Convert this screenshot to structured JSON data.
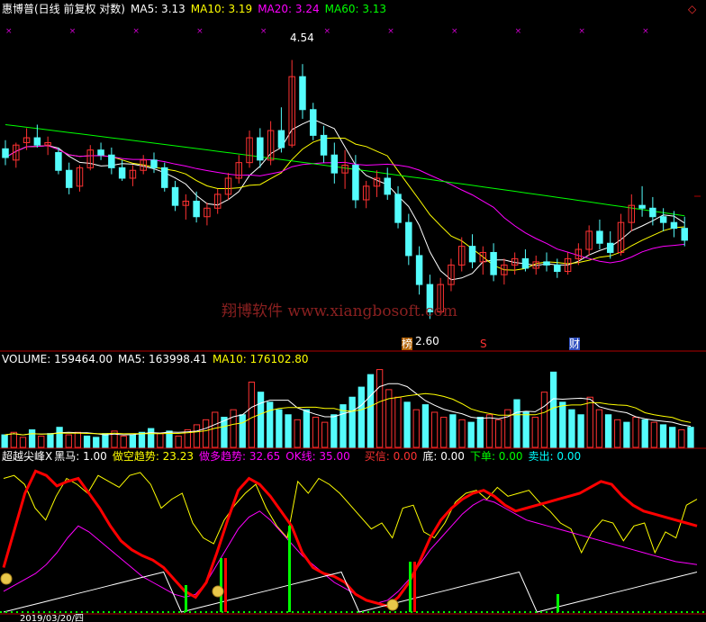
{
  "colors": {
    "bg": "#000000",
    "up": "#ff3232",
    "down": "#54fcfc",
    "ma5": "#ffffff",
    "ma10": "#ffff00",
    "ma20": "#ff00ff",
    "ma60": "#00ff00",
    "frame": "#b00000",
    "heima": "#ff0000",
    "kongtrend": "#ffff00",
    "duotrend": "#ff00ff",
    "ok": "#ffffff",
    "signal_green": "#00ff00",
    "watermark": "#7a1a1a"
  },
  "header": {
    "stock": "惠博普(日线 前复权 对数)",
    "ma5": "MA5: 3.13",
    "ma10": "MA10: 3.19",
    "ma20": "MA20: 3.24",
    "ma60": "MA60: 3.13"
  },
  "main_annotations": {
    "high_label": "4.54",
    "low_label": "2.60",
    "tag_bang": "榜",
    "tag_s": "S",
    "tag_cai": "财",
    "watermark": "翔博软件 www.xiangbosoft.com",
    "x_mark": "×",
    "diamond": "◇"
  },
  "volume_header": {
    "volume": "VOLUME: 159464.00",
    "ma5": "MA5: 163998.41",
    "ma10": "MA10: 176102.80"
  },
  "indicator_header": {
    "name": "超越尖峰X",
    "heima": "黑马: 1.00",
    "kong": "做空趋势: 23.23",
    "duo": "做多趋势: 32.65",
    "ok": "OK线: 35.00",
    "buy": "买信: 0.00",
    "bottom": "底: 0.00",
    "order": "下单: 0.00",
    "sell": "卖出: 0.00"
  },
  "date_label": "2019/03/20/四",
  "chart_data": [
    {
      "type": "candlestick",
      "title": "惠博普(日线 前复权 对数)",
      "series_names": [
        "MA5",
        "MA10",
        "MA20",
        "MA60"
      ],
      "y_range_estimate": [
        2.45,
        4.95
      ],
      "highest_labeled": 4.54,
      "lowest_labeled": 2.6,
      "ohlc": [
        [
          3.75,
          3.82,
          3.62,
          3.68
        ],
        [
          3.66,
          3.8,
          3.6,
          3.78
        ],
        [
          3.8,
          3.92,
          3.74,
          3.84
        ],
        [
          3.84,
          3.95,
          3.76,
          3.78
        ],
        [
          3.78,
          3.85,
          3.7,
          3.8
        ],
        [
          3.72,
          3.76,
          3.55,
          3.58
        ],
        [
          3.58,
          3.64,
          3.4,
          3.45
        ],
        [
          3.46,
          3.62,
          3.42,
          3.6
        ],
        [
          3.6,
          3.78,
          3.58,
          3.74
        ],
        [
          3.74,
          3.8,
          3.66,
          3.7
        ],
        [
          3.7,
          3.76,
          3.55,
          3.6
        ],
        [
          3.6,
          3.66,
          3.5,
          3.52
        ],
        [
          3.52,
          3.62,
          3.46,
          3.58
        ],
        [
          3.58,
          3.7,
          3.55,
          3.66
        ],
        [
          3.66,
          3.72,
          3.56,
          3.6
        ],
        [
          3.6,
          3.64,
          3.42,
          3.45
        ],
        [
          3.45,
          3.5,
          3.28,
          3.32
        ],
        [
          3.32,
          3.4,
          3.22,
          3.35
        ],
        [
          3.35,
          3.42,
          3.2,
          3.24
        ],
        [
          3.24,
          3.34,
          3.18,
          3.3
        ],
        [
          3.3,
          3.44,
          3.26,
          3.4
        ],
        [
          3.4,
          3.56,
          3.36,
          3.52
        ],
        [
          3.52,
          3.7,
          3.48,
          3.64
        ],
        [
          3.64,
          3.9,
          3.6,
          3.84
        ],
        [
          3.84,
          3.92,
          3.6,
          3.66
        ],
        [
          3.66,
          3.98,
          3.62,
          3.9
        ],
        [
          3.9,
          4.1,
          3.72,
          3.76
        ],
        [
          3.78,
          4.54,
          3.76,
          4.38
        ],
        [
          4.38,
          4.5,
          4.0,
          4.08
        ],
        [
          4.08,
          4.14,
          3.82,
          3.86
        ],
        [
          3.86,
          3.94,
          3.64,
          3.7
        ],
        [
          3.7,
          3.8,
          3.48,
          3.56
        ],
        [
          3.56,
          3.74,
          3.44,
          3.62
        ],
        [
          3.62,
          3.7,
          3.3,
          3.36
        ],
        [
          3.36,
          3.5,
          3.3,
          3.46
        ],
        [
          3.46,
          3.58,
          3.38,
          3.52
        ],
        [
          3.52,
          3.6,
          3.36,
          3.4
        ],
        [
          3.4,
          3.46,
          3.16,
          3.2
        ],
        [
          3.2,
          3.26,
          2.92,
          2.98
        ],
        [
          2.98,
          3.04,
          2.74,
          2.8
        ],
        [
          2.8,
          2.86,
          2.6,
          2.64
        ],
        [
          2.64,
          2.84,
          2.62,
          2.8
        ],
        [
          2.8,
          2.96,
          2.76,
          2.92
        ],
        [
          2.92,
          3.1,
          2.88,
          3.04
        ],
        [
          3.04,
          3.12,
          2.9,
          2.94
        ],
        [
          2.94,
          3.04,
          2.86,
          3.0
        ],
        [
          3.0,
          3.06,
          2.82,
          2.86
        ],
        [
          2.86,
          2.96,
          2.8,
          2.92
        ],
        [
          2.92,
          3.0,
          2.86,
          2.96
        ],
        [
          2.96,
          3.02,
          2.88,
          2.9
        ],
        [
          2.9,
          2.98,
          2.86,
          2.94
        ],
        [
          2.94,
          3.0,
          2.88,
          2.92
        ],
        [
          2.92,
          2.96,
          2.84,
          2.88
        ],
        [
          2.88,
          3.0,
          2.86,
          2.96
        ],
        [
          2.96,
          3.06,
          2.92,
          3.02
        ],
        [
          3.02,
          3.18,
          2.98,
          3.14
        ],
        [
          3.14,
          3.22,
          3.02,
          3.06
        ],
        [
          3.06,
          3.14,
          2.96,
          3.0
        ],
        [
          3.0,
          3.26,
          2.98,
          3.2
        ],
        [
          3.2,
          3.4,
          3.14,
          3.32
        ],
        [
          3.32,
          3.46,
          3.24,
          3.3
        ],
        [
          3.3,
          3.38,
          3.18,
          3.24
        ],
        [
          3.24,
          3.3,
          3.14,
          3.2
        ],
        [
          3.2,
          3.28,
          3.1,
          3.16
        ],
        [
          3.16,
          3.24,
          3.04,
          3.08
        ]
      ],
      "approx_ma5_last": 3.13,
      "approx_ma10_last": 3.19,
      "approx_ma20_last": 3.24,
      "approx_ma60_last": 3.13
    },
    {
      "type": "bar",
      "title": "VOLUME",
      "last_volume": 159464.0,
      "ma5": 163998.41,
      "ma10": 176102.8,
      "values": [
        10,
        12,
        8,
        14,
        9,
        11,
        16,
        10,
        12,
        9,
        8,
        11,
        13,
        9,
        10,
        12,
        15,
        11,
        13,
        9,
        14,
        18,
        22,
        28,
        24,
        30,
        26,
        52,
        44,
        36,
        30,
        26,
        22,
        30,
        24,
        20,
        26,
        34,
        40,
        48,
        58,
        62,
        46,
        40,
        36,
        30,
        34,
        28,
        24,
        26,
        22,
        20,
        24,
        26,
        22,
        30,
        38,
        28,
        24,
        44,
        60,
        36,
        30,
        26,
        40,
        30,
        26,
        22,
        20,
        24,
        22,
        20,
        18,
        16,
        14,
        16
      ],
      "color_flags": [
        "d",
        "u",
        "u",
        "d",
        "u",
        "d",
        "d",
        "u",
        "u",
        "d",
        "d",
        "d",
        "u",
        "u",
        "d",
        "d",
        "d",
        "u",
        "d",
        "u",
        "u",
        "u",
        "u",
        "u",
        "d",
        "u",
        "d",
        "u",
        "d",
        "d",
        "d",
        "d",
        "u",
        "d",
        "u",
        "u",
        "d",
        "d",
        "d",
        "d",
        "d",
        "u",
        "u",
        "u",
        "d",
        "u",
        "d",
        "u",
        "u",
        "d",
        "u",
        "d",
        "d",
        "u",
        "u",
        "u",
        "d",
        "d",
        "u",
        "u",
        "d",
        "d",
        "d",
        "d",
        "u",
        "u",
        "d",
        "u",
        "d",
        "u",
        "d",
        "u",
        "d",
        "d",
        "u",
        "d"
      ]
    },
    {
      "type": "line",
      "title": "超越尖峰X",
      "series": [
        {
          "name": "黑马",
          "last": 1.0
        },
        {
          "name": "做空趋势",
          "last": 23.23
        },
        {
          "name": "做多趋势",
          "last": 32.65
        },
        {
          "name": "OK线",
          "last": 35.0
        },
        {
          "name": "买信",
          "last": 0.0
        },
        {
          "name": "底",
          "last": 0.0
        },
        {
          "name": "下单",
          "last": 0.0
        },
        {
          "name": "卖出",
          "last": 0.0
        }
      ],
      "heavy_red_series": [
        30,
        55,
        80,
        95,
        92,
        85,
        88,
        90,
        80,
        70,
        58,
        48,
        42,
        38,
        35,
        30,
        22,
        14,
        10,
        20,
        40,
        62,
        82,
        90,
        86,
        78,
        68,
        58,
        40,
        30,
        26,
        24,
        20,
        12,
        8,
        6,
        4,
        10,
        20,
        34,
        50,
        62,
        70,
        76,
        80,
        82,
        78,
        72,
        68,
        70,
        72,
        74,
        76,
        78,
        80,
        84,
        88,
        86,
        78,
        72,
        68,
        66,
        64,
        62,
        60,
        58
      ],
      "kong_series": [
        90,
        92,
        86,
        70,
        62,
        78,
        90,
        86,
        80,
        92,
        88,
        84,
        92,
        94,
        86,
        70,
        76,
        80,
        60,
        50,
        46,
        62,
        72,
        80,
        86,
        70,
        58,
        50,
        88,
        80,
        90,
        86,
        80,
        72,
        64,
        56,
        60,
        50,
        70,
        72,
        54,
        50,
        60,
        74,
        80,
        82,
        76,
        84,
        78,
        80,
        82,
        74,
        68,
        60,
        56,
        40,
        54,
        62,
        60,
        48,
        58,
        60,
        40,
        54,
        50,
        72,
        76
      ],
      "duo_series": [
        14,
        18,
        22,
        26,
        32,
        40,
        50,
        58,
        54,
        48,
        42,
        36,
        30,
        24,
        20,
        16,
        12,
        10,
        12,
        20,
        32,
        44,
        56,
        64,
        68,
        62,
        54,
        46,
        38,
        32,
        26,
        20,
        16,
        12,
        8,
        6,
        8,
        14,
        22,
        32,
        42,
        50,
        58,
        66,
        72,
        76,
        74,
        70,
        66,
        62,
        60,
        58,
        56,
        54,
        52,
        50,
        48,
        46,
        44,
        42,
        40,
        38,
        36,
        34,
        33,
        32
      ]
    }
  ]
}
